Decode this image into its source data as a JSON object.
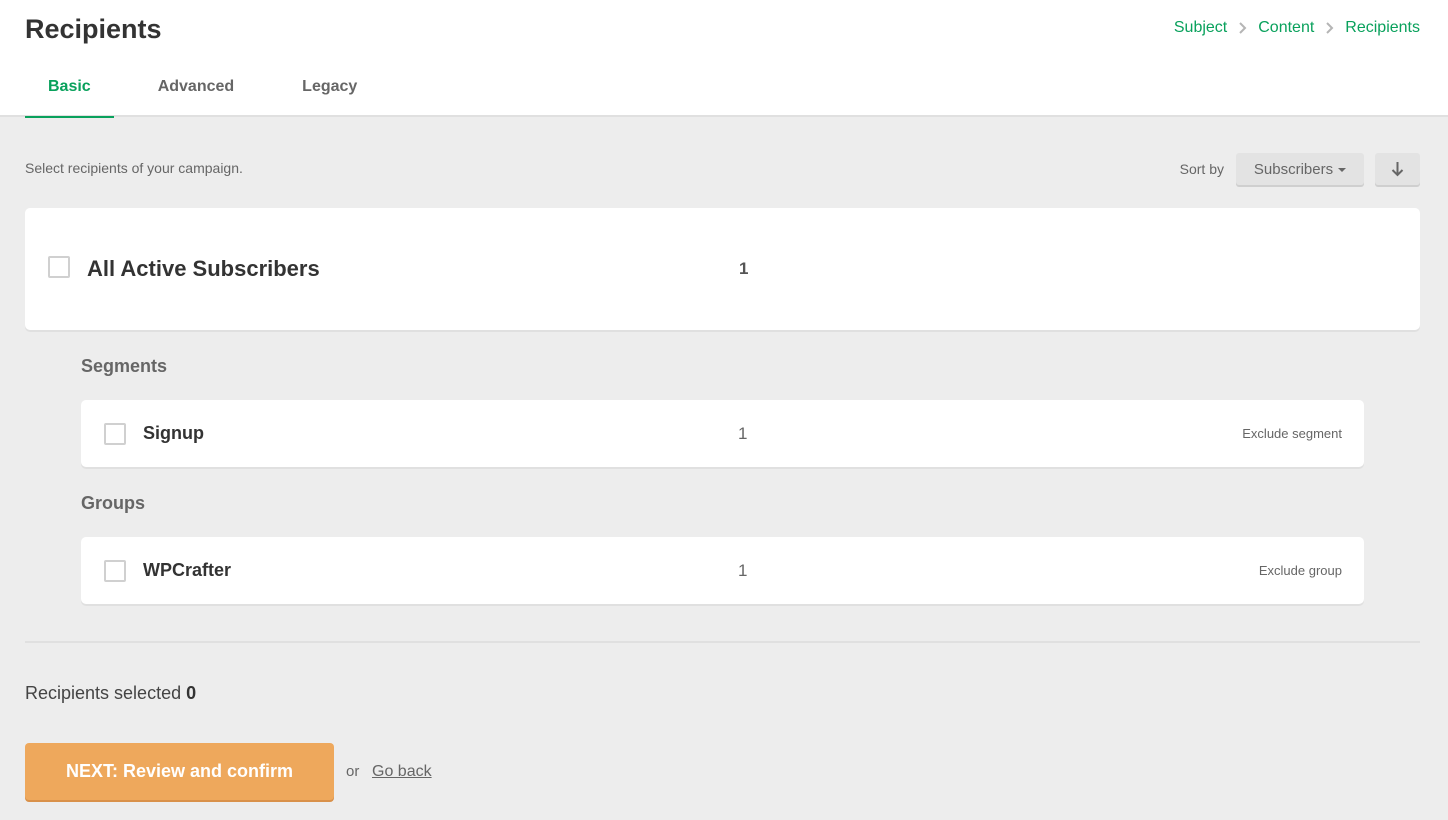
{
  "header": {
    "title": "Recipients",
    "breadcrumb": [
      {
        "label": "Subject"
      },
      {
        "label": "Content"
      },
      {
        "label": "Recipients"
      }
    ],
    "tabs": [
      {
        "label": "Basic",
        "active": true
      },
      {
        "label": "Advanced",
        "active": false
      },
      {
        "label": "Legacy",
        "active": false
      }
    ]
  },
  "toolbar": {
    "intro": "Select recipients of your campaign.",
    "sort_label": "Sort by",
    "sort_value": "Subscribers",
    "sort_direction_icon": "arrow-down-icon"
  },
  "all_subscribers": {
    "label": "All Active Subscribers",
    "count": "1",
    "checked": false
  },
  "segments": {
    "title": "Segments",
    "items": [
      {
        "name": "Signup",
        "count": "1",
        "exclude_label": "Exclude segment",
        "checked": false
      }
    ]
  },
  "groups": {
    "title": "Groups",
    "items": [
      {
        "name": "WPCrafter",
        "count": "1",
        "exclude_label": "Exclude group",
        "checked": false
      }
    ]
  },
  "footer": {
    "selected_label": "Recipients selected",
    "selected_count": "0",
    "next_button": "NEXT: Review and confirm",
    "or_text": "or",
    "go_back": "Go back"
  },
  "colors": {
    "accent_green": "#09a15c",
    "next_button_orange": "#eea85c",
    "background": "#ededed"
  }
}
